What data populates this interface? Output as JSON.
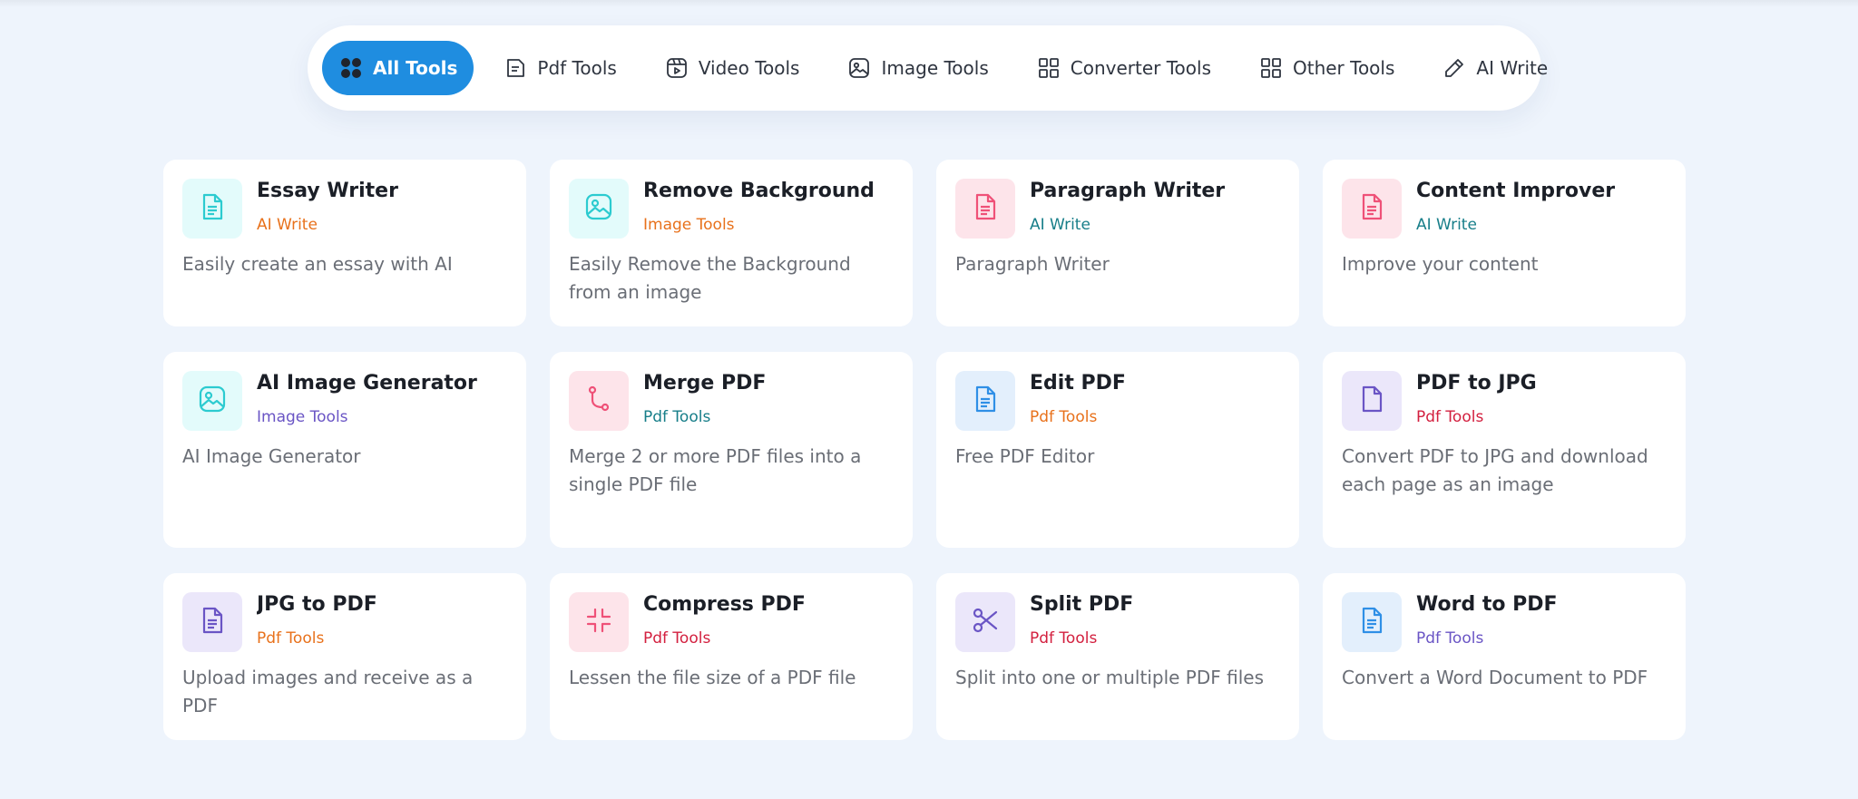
{
  "tabs": [
    {
      "label": "All Tools",
      "icon": "grid-dots-icon",
      "active": true
    },
    {
      "label": "Pdf Tools",
      "icon": "file-icon"
    },
    {
      "label": "Video Tools",
      "icon": "video-icon"
    },
    {
      "label": "Image Tools",
      "icon": "image-icon"
    },
    {
      "label": "Converter Tools",
      "icon": "grid-icon"
    },
    {
      "label": "Other Tools",
      "icon": "grid-icon"
    },
    {
      "label": "AI Write",
      "icon": "pencil-icon"
    }
  ],
  "colors": {
    "accent": "#1f8de0",
    "cat_orange": "#e8711b",
    "cat_teal": "#177e89",
    "cat_purple": "#6a55c5",
    "cat_red": "#d3203f"
  },
  "cards": [
    {
      "title": "Essay Writer",
      "category": "AI Write",
      "description": "Easily create an essay with AI",
      "icon": "document-icon",
      "icon_color": "#2ccbd0",
      "tile_color": "#e3fbfb",
      "category_color": "#e8711b"
    },
    {
      "title": "Remove Background",
      "category": "Image Tools",
      "description": "Easily Remove the Background from an image",
      "icon": "image-icon",
      "icon_color": "#2ccbd0",
      "tile_color": "#e3fbfb",
      "category_color": "#e8711b"
    },
    {
      "title": "Paragraph Writer",
      "category": "AI Write",
      "description": "Paragraph Writer",
      "icon": "document-icon",
      "icon_color": "#ef5178",
      "tile_color": "#fde4ea",
      "category_color": "#177e89"
    },
    {
      "title": "Content Improver",
      "category": "AI Write",
      "description": "Improve your content",
      "icon": "document-icon",
      "icon_color": "#ef5178",
      "tile_color": "#fde4ea",
      "category_color": "#177e89"
    },
    {
      "title": "AI Image Generator",
      "category": "Image Tools",
      "description": "AI Image Generator",
      "icon": "image-icon",
      "icon_color": "#2ccbd0",
      "tile_color": "#e3fbfb",
      "category_color": "#6a55c5"
    },
    {
      "title": "Merge PDF",
      "category": "Pdf Tools",
      "description": "Merge 2 or more PDF files into a single PDF file",
      "icon": "merge-icon",
      "icon_color": "#ef5178",
      "tile_color": "#fde4ea",
      "category_color": "#177e89"
    },
    {
      "title": "Edit PDF",
      "category": "Pdf Tools",
      "description": "Free PDF Editor",
      "icon": "document-icon",
      "icon_color": "#2f8fe6",
      "tile_color": "#e3effc",
      "category_color": "#e8711b"
    },
    {
      "title": "PDF to JPG",
      "category": "Pdf Tools",
      "description": "Convert PDF to JPG and download each page as an image",
      "icon": "file-blank-icon",
      "icon_color": "#6a55c5",
      "tile_color": "#ebe7fa",
      "category_color": "#d3203f"
    },
    {
      "title": "JPG to PDF",
      "category": "Pdf Tools",
      "description": "Upload images and receive as a PDF",
      "icon": "document-icon",
      "icon_color": "#6a55c5",
      "tile_color": "#ebe7fa",
      "category_color": "#e8711b"
    },
    {
      "title": "Compress PDF",
      "category": "Pdf Tools",
      "description": "Lessen the file size of a PDF file",
      "icon": "compress-icon",
      "icon_color": "#ef5178",
      "tile_color": "#fde4ea",
      "category_color": "#d3203f"
    },
    {
      "title": "Split PDF",
      "category": "Pdf Tools",
      "description": "Split into one or multiple PDF files",
      "icon": "scissors-icon",
      "icon_color": "#6a55c5",
      "tile_color": "#ebe7fa",
      "category_color": "#d3203f"
    },
    {
      "title": "Word to PDF",
      "category": "Pdf Tools",
      "description": "Convert a Word Document to PDF",
      "icon": "document-icon",
      "icon_color": "#2f8fe6",
      "tile_color": "#e3effc",
      "category_color": "#6a55c5"
    }
  ]
}
